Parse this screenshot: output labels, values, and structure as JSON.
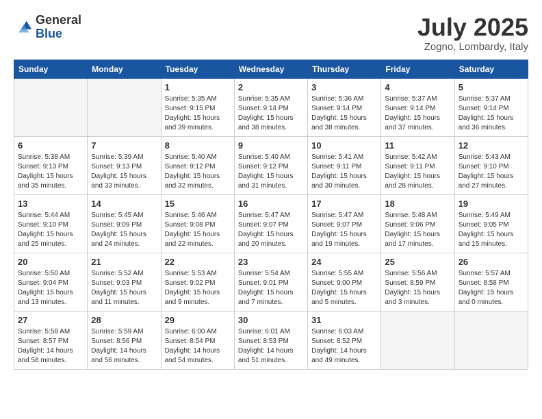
{
  "header": {
    "logo_line1": "General",
    "logo_line2": "Blue",
    "month": "July 2025",
    "location": "Zogno, Lombardy, Italy"
  },
  "weekdays": [
    "Sunday",
    "Monday",
    "Tuesday",
    "Wednesday",
    "Thursday",
    "Friday",
    "Saturday"
  ],
  "weeks": [
    [
      {
        "day": "",
        "info": ""
      },
      {
        "day": "",
        "info": ""
      },
      {
        "day": "1",
        "info": "Sunrise: 5:35 AM\nSunset: 9:15 PM\nDaylight: 15 hours\nand 39 minutes."
      },
      {
        "day": "2",
        "info": "Sunrise: 5:35 AM\nSunset: 9:14 PM\nDaylight: 15 hours\nand 38 minutes."
      },
      {
        "day": "3",
        "info": "Sunrise: 5:36 AM\nSunset: 9:14 PM\nDaylight: 15 hours\nand 38 minutes."
      },
      {
        "day": "4",
        "info": "Sunrise: 5:37 AM\nSunset: 9:14 PM\nDaylight: 15 hours\nand 37 minutes."
      },
      {
        "day": "5",
        "info": "Sunrise: 5:37 AM\nSunset: 9:14 PM\nDaylight: 15 hours\nand 36 minutes."
      }
    ],
    [
      {
        "day": "6",
        "info": "Sunrise: 5:38 AM\nSunset: 9:13 PM\nDaylight: 15 hours\nand 35 minutes."
      },
      {
        "day": "7",
        "info": "Sunrise: 5:39 AM\nSunset: 9:13 PM\nDaylight: 15 hours\nand 33 minutes."
      },
      {
        "day": "8",
        "info": "Sunrise: 5:40 AM\nSunset: 9:12 PM\nDaylight: 15 hours\nand 32 minutes."
      },
      {
        "day": "9",
        "info": "Sunrise: 5:40 AM\nSunset: 9:12 PM\nDaylight: 15 hours\nand 31 minutes."
      },
      {
        "day": "10",
        "info": "Sunrise: 5:41 AM\nSunset: 9:11 PM\nDaylight: 15 hours\nand 30 minutes."
      },
      {
        "day": "11",
        "info": "Sunrise: 5:42 AM\nSunset: 9:11 PM\nDaylight: 15 hours\nand 28 minutes."
      },
      {
        "day": "12",
        "info": "Sunrise: 5:43 AM\nSunset: 9:10 PM\nDaylight: 15 hours\nand 27 minutes."
      }
    ],
    [
      {
        "day": "13",
        "info": "Sunrise: 5:44 AM\nSunset: 9:10 PM\nDaylight: 15 hours\nand 25 minutes."
      },
      {
        "day": "14",
        "info": "Sunrise: 5:45 AM\nSunset: 9:09 PM\nDaylight: 15 hours\nand 24 minutes."
      },
      {
        "day": "15",
        "info": "Sunrise: 5:46 AM\nSunset: 9:08 PM\nDaylight: 15 hours\nand 22 minutes."
      },
      {
        "day": "16",
        "info": "Sunrise: 5:47 AM\nSunset: 9:07 PM\nDaylight: 15 hours\nand 20 minutes."
      },
      {
        "day": "17",
        "info": "Sunrise: 5:47 AM\nSunset: 9:07 PM\nDaylight: 15 hours\nand 19 minutes."
      },
      {
        "day": "18",
        "info": "Sunrise: 5:48 AM\nSunset: 9:06 PM\nDaylight: 15 hours\nand 17 minutes."
      },
      {
        "day": "19",
        "info": "Sunrise: 5:49 AM\nSunset: 9:05 PM\nDaylight: 15 hours\nand 15 minutes."
      }
    ],
    [
      {
        "day": "20",
        "info": "Sunrise: 5:50 AM\nSunset: 9:04 PM\nDaylight: 15 hours\nand 13 minutes."
      },
      {
        "day": "21",
        "info": "Sunrise: 5:52 AM\nSunset: 9:03 PM\nDaylight: 15 hours\nand 11 minutes."
      },
      {
        "day": "22",
        "info": "Sunrise: 5:53 AM\nSunset: 9:02 PM\nDaylight: 15 hours\nand 9 minutes."
      },
      {
        "day": "23",
        "info": "Sunrise: 5:54 AM\nSunset: 9:01 PM\nDaylight: 15 hours\nand 7 minutes."
      },
      {
        "day": "24",
        "info": "Sunrise: 5:55 AM\nSunset: 9:00 PM\nDaylight: 15 hours\nand 5 minutes."
      },
      {
        "day": "25",
        "info": "Sunrise: 5:56 AM\nSunset: 8:59 PM\nDaylight: 15 hours\nand 3 minutes."
      },
      {
        "day": "26",
        "info": "Sunrise: 5:57 AM\nSunset: 8:58 PM\nDaylight: 15 hours\nand 0 minutes."
      }
    ],
    [
      {
        "day": "27",
        "info": "Sunrise: 5:58 AM\nSunset: 8:57 PM\nDaylight: 14 hours\nand 58 minutes."
      },
      {
        "day": "28",
        "info": "Sunrise: 5:59 AM\nSunset: 8:56 PM\nDaylight: 14 hours\nand 56 minutes."
      },
      {
        "day": "29",
        "info": "Sunrise: 6:00 AM\nSunset: 8:54 PM\nDaylight: 14 hours\nand 54 minutes."
      },
      {
        "day": "30",
        "info": "Sunrise: 6:01 AM\nSunset: 8:53 PM\nDaylight: 14 hours\nand 51 minutes."
      },
      {
        "day": "31",
        "info": "Sunrise: 6:03 AM\nSunset: 8:52 PM\nDaylight: 14 hours\nand 49 minutes."
      },
      {
        "day": "",
        "info": ""
      },
      {
        "day": "",
        "info": ""
      }
    ]
  ]
}
